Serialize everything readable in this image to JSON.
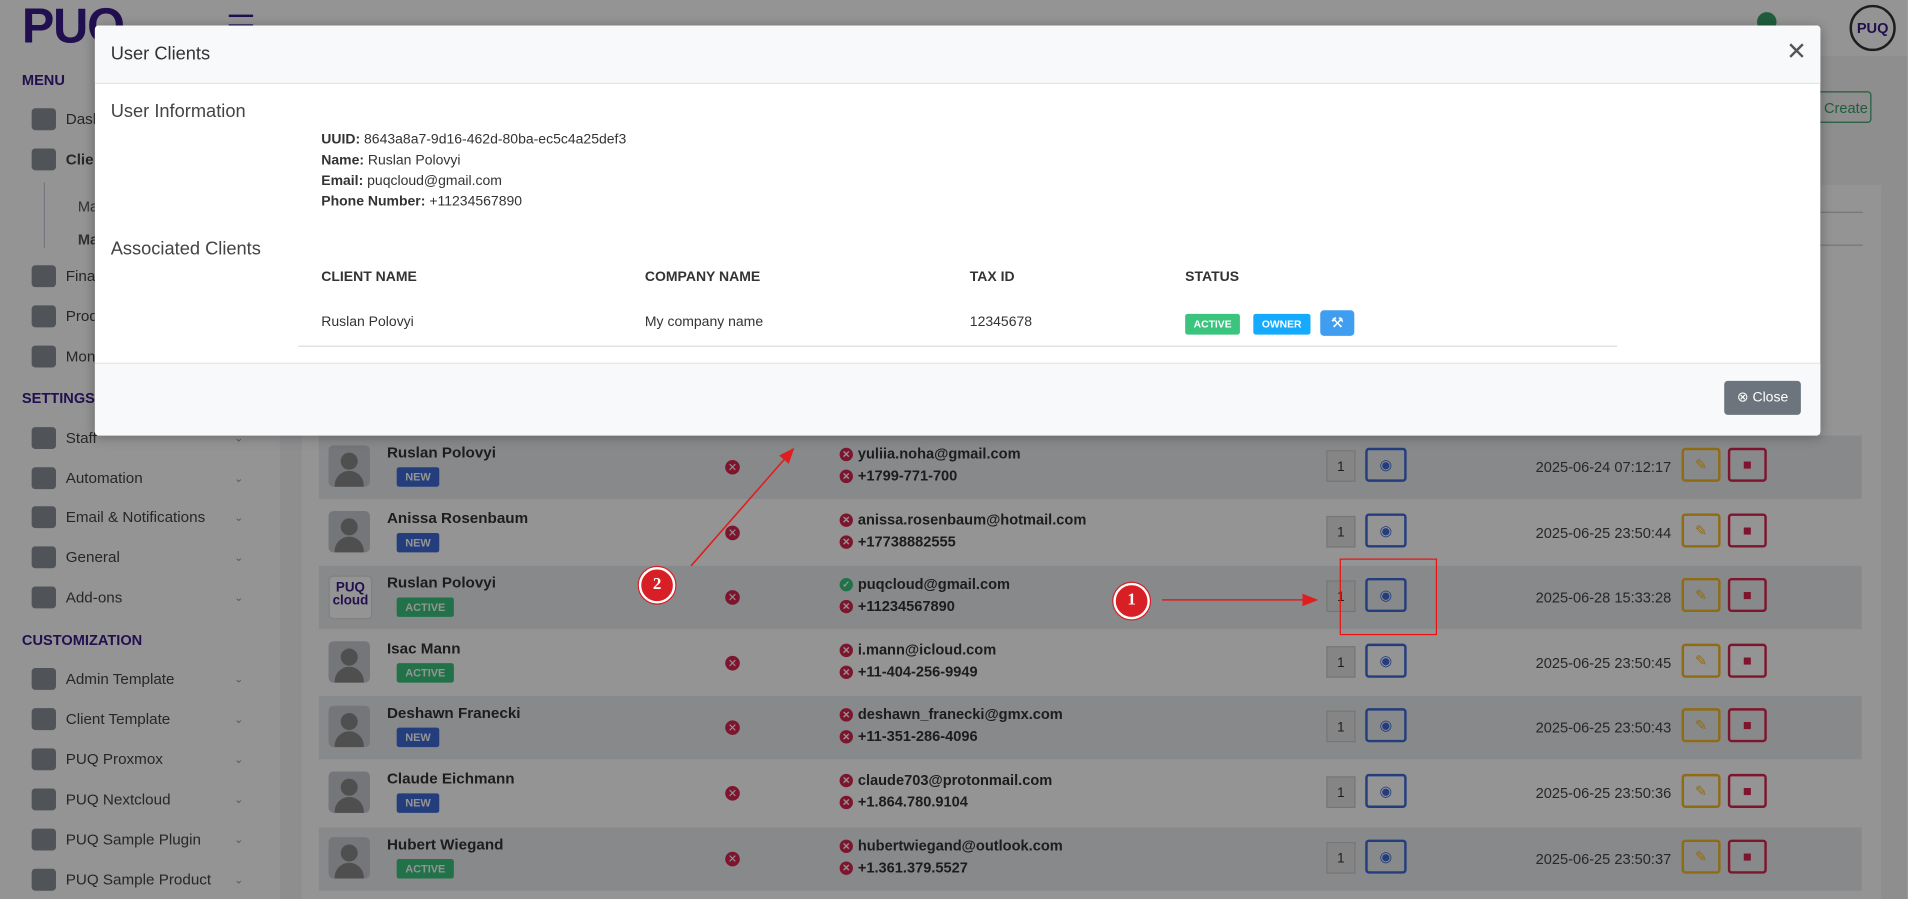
{
  "app": {
    "logo": "PUQ",
    "avatar_text": "PUQ",
    "create_label": "Create"
  },
  "sidebar": {
    "menu_title": "MENU",
    "settings_title": "SETTINGS",
    "customization_title": "CUSTOMIZATION",
    "menu_items": [
      "Dash",
      "Clie",
      "Finan",
      "Prod",
      "Mon"
    ],
    "sub_items": [
      "Ma",
      "Ma"
    ],
    "settings_items": [
      "Staff",
      "Automation",
      "Email & Notifications",
      "General",
      "Add-ons"
    ],
    "customization_items": [
      "Admin Template",
      "Client Template",
      "PUQ Proxmox",
      "PUQ Nextcloud",
      "PUQ Sample Plugin",
      "PUQ Sample Product"
    ]
  },
  "table": {
    "rows": [
      {
        "name": "Ruslan Polovyi",
        "badge": "NEW",
        "email": "yuliia.noha@gmail.com",
        "phone": "+1799-771-700",
        "count": "1",
        "date": "2025-06-24 07:12:17"
      },
      {
        "name": "Anissa Rosenbaum",
        "badge": "NEW",
        "email": "anissa.rosenbaum@hotmail.com",
        "phone": "+17738882555",
        "count": "1",
        "date": "2025-06-25 23:50:44"
      },
      {
        "name": "Ruslan Polovyi",
        "badge": "ACTIVE",
        "email": "puqcloud@gmail.com",
        "phone": "+11234567890",
        "count": "1",
        "date": "2025-06-28 15:33:28"
      },
      {
        "name": "Isac Mann",
        "badge": "ACTIVE",
        "email": "i.mann@icloud.com",
        "phone": "+11-404-256-9949",
        "count": "1",
        "date": "2025-06-25 23:50:45"
      },
      {
        "name": "Deshawn Franecki",
        "badge": "NEW",
        "email": "deshawn_franecki@gmx.com",
        "phone": "+11-351-286-4096",
        "count": "1",
        "date": "2025-06-25 23:50:43"
      },
      {
        "name": "Claude Eichmann",
        "badge": "NEW",
        "email": "claude703@protonmail.com",
        "phone": "+1.864.780.9104",
        "count": "1",
        "date": "2025-06-25 23:50:36"
      },
      {
        "name": "Hubert Wiegand",
        "badge": "ACTIVE",
        "email": "hubertwiegand@outlook.com",
        "phone": "+1.361.379.5527",
        "count": "1",
        "date": "2025-06-25 23:50:37"
      }
    ],
    "puq_logo_top": "PUQ",
    "puq_logo_bottom": "cloud"
  },
  "modal": {
    "title": "User Clients",
    "user_info_heading": "User Information",
    "uuid_label": "UUID:",
    "uuid": "8643a8a7-9d16-462d-80ba-ec5c4a25def3",
    "name_label": "Name:",
    "name": "Ruslan Polovyi",
    "email_label": "Email:",
    "email": "puqcloud@gmail.com",
    "phone_label": "Phone Number:",
    "phone": "+11234567890",
    "clients_heading": "Associated Clients",
    "columns": [
      "CLIENT NAME",
      "COMPANY NAME",
      "TAX ID",
      "STATUS"
    ],
    "client": {
      "name": "Ruslan Polovyi",
      "company": "My company name",
      "tax_id": "12345678",
      "status": "ACTIVE",
      "role": "OWNER"
    },
    "close_label": "Close"
  },
  "annotations": {
    "marker1": "1",
    "marker2": "2",
    "color": "#e11d1d"
  },
  "icons": {
    "close": "close-icon",
    "eye": "eye-icon",
    "edit": "edit-icon",
    "delete": "trash-icon",
    "wrench": "wrench-icon"
  }
}
